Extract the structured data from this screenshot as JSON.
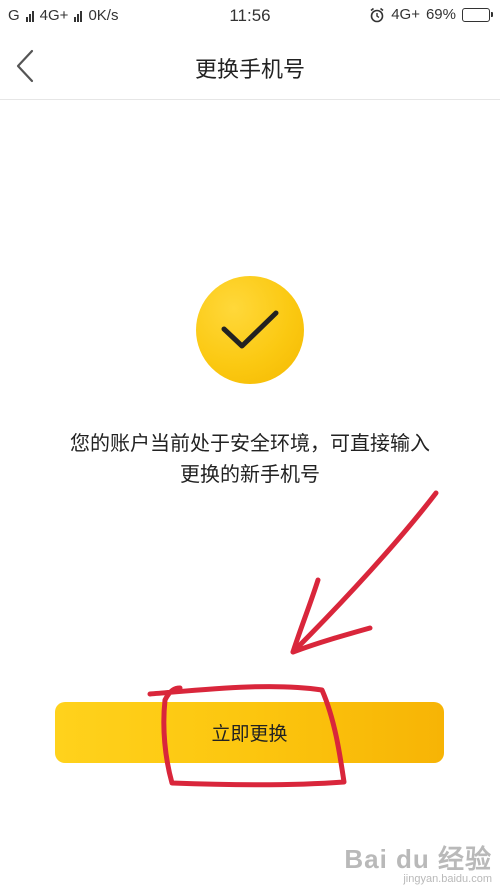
{
  "status_bar": {
    "carrier1": "G",
    "carrier2": "4G+",
    "net_speed": "0K/s",
    "time": "11:56",
    "network_right": "4G+",
    "battery_percent": "69%",
    "battery_level": 0.69,
    "battery_color": "#f5c200"
  },
  "nav": {
    "title": "更换手机号",
    "back_icon": "chevron-left-icon"
  },
  "content": {
    "success_icon": "check-icon",
    "badge_color": "#fbc912",
    "message_line1": "您的账户当前处于安全环境，可直接输入",
    "message_line2": "更换的新手机号"
  },
  "action": {
    "confirm_label": "立即更换",
    "button_color": "#fcc60f"
  },
  "annotation": {
    "color": "#d9263b"
  },
  "watermark": {
    "main": "Bai du 经验",
    "sub": "jingyan.baidu.com"
  }
}
